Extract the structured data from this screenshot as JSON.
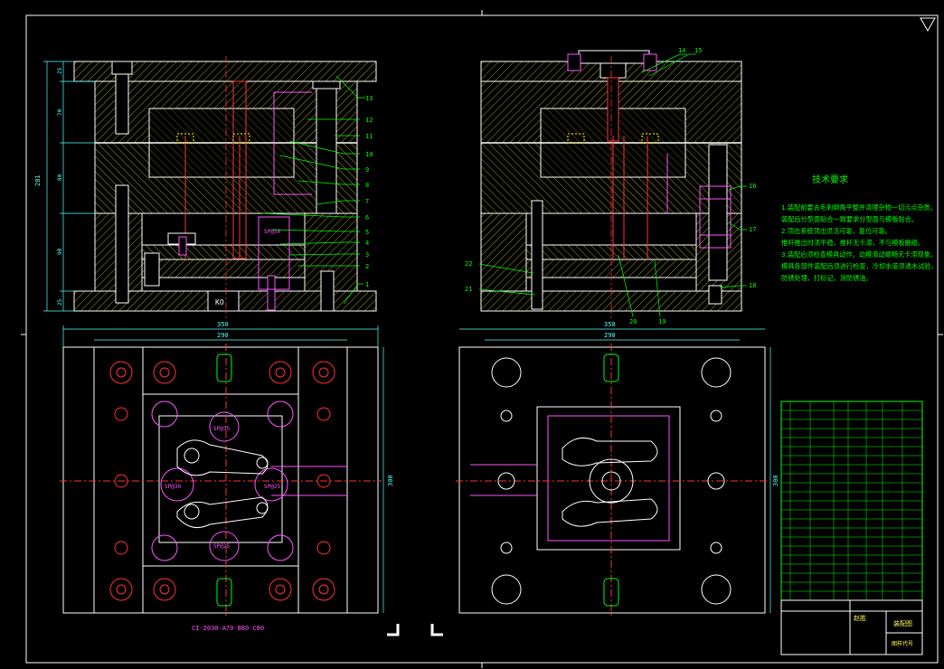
{
  "drawing": {
    "model_code": "CI-2030-A70-B80-C80",
    "dims": {
      "front_height": "281",
      "front_heights": [
        "25",
        "70",
        "80",
        "90",
        "25"
      ],
      "top_width_outer": "350",
      "top_width_inner": "290",
      "side_width_outer": "350",
      "side_width_inner": "290",
      "plan_height_left": "300",
      "plan_height_right": "300"
    },
    "view_labels": {
      "ko": "KO",
      "sp_labels": [
        "SP@50",
        "SP@35",
        "SP@30",
        "SP@25",
        "SP@25",
        "SP@28"
      ]
    },
    "callouts_left": [
      "1",
      "2",
      "3",
      "4",
      "5",
      "6",
      "7",
      "8",
      "9",
      "10",
      "11",
      "12",
      "13"
    ],
    "callouts_right": [
      "14",
      "15",
      "16",
      "17",
      "18",
      "19",
      "20",
      "21",
      "22"
    ],
    "notes": {
      "title": "技术要求",
      "lines": [
        "1.装配前要去毛刺倒角平整并清理杂物一切污点杂质。",
        "  装配后分型面贴合一致要求分型面与模板贴合。",
        "2.顶出系统顶出灵活可靠，复位可靠。",
        "  推杆推出时须平稳，推杆无卡滞，不与模板触碰。",
        "3.装配后须检查模具动作。动模滑动顺畅无卡滞现象。",
        "  模具各部件装配后须进行检查，冷却水道须通水试验，",
        "  防锈处理，打标记，涂防锈油。"
      ]
    },
    "title_block": {
      "designer_label": "赵胜",
      "drawing_name": "装配图",
      "part_code_label": "图样代号",
      "rows": 22
    },
    "colors": {
      "outline": "#ffffff",
      "hatch": "#ffff55",
      "centerline": "#ff3333",
      "green": "#00ff00",
      "magenta": "#ff00ff",
      "cyan": "#55ffff",
      "blue": "#5555ff"
    }
  }
}
